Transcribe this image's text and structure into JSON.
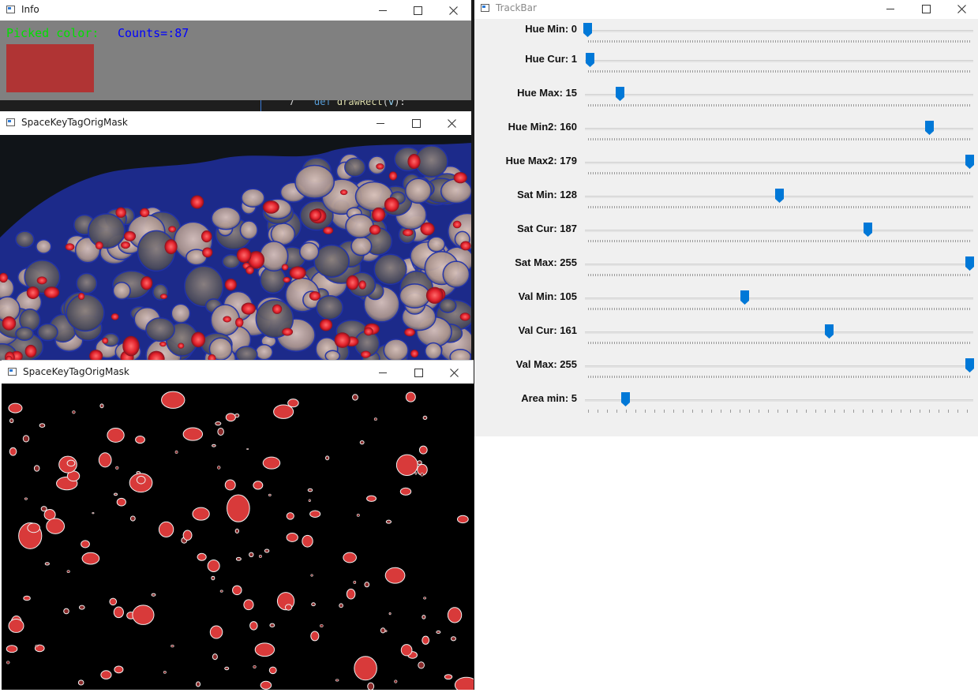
{
  "info_window": {
    "title": "Info",
    "picked_label": "Picked color:",
    "counts_label": "Counts=:87",
    "picked_label_color": "#00e000",
    "counts_label_color": "#0000ff",
    "swatch_color": "#b03434",
    "background_color": "#808080"
  },
  "code_peek": {
    "line_number": "7",
    "keyword": "def",
    "function_name": "drawRect",
    "param": "v",
    "tail": "):"
  },
  "tissue_window": {
    "title": "SpaceKeyTagOrigMask"
  },
  "mask_window": {
    "title": "SpaceKeyTagOrigMask"
  },
  "trackbar_window": {
    "title": "TrackBar",
    "accent": "#0078d7",
    "trackbars": [
      {
        "label": "Hue Min: 0",
        "value": 0,
        "max": 179
      },
      {
        "label": "Hue Cur: 1",
        "value": 1,
        "max": 179
      },
      {
        "label": "Hue Max: 15",
        "value": 15,
        "max": 179
      },
      {
        "label": "Hue Min2: 160",
        "value": 160,
        "max": 179
      },
      {
        "label": "Hue Max2: 179",
        "value": 179,
        "max": 179
      },
      {
        "label": "Sat Min: 128",
        "value": 128,
        "max": 255
      },
      {
        "label": "Sat Cur: 187",
        "value": 187,
        "max": 255
      },
      {
        "label": "Sat Max: 255",
        "value": 255,
        "max": 255
      },
      {
        "label": "Val Min: 105",
        "value": 105,
        "max": 255
      },
      {
        "label": "Val Cur: 161",
        "value": 161,
        "max": 255
      },
      {
        "label": "Val Max: 255",
        "value": 255,
        "max": 255
      },
      {
        "label": "Area min: 5",
        "value": 5,
        "max": 50
      }
    ]
  },
  "window_controls": {
    "minimize_icon": "minimize-icon",
    "maximize_icon": "maximize-icon",
    "close_icon": "close-icon"
  }
}
